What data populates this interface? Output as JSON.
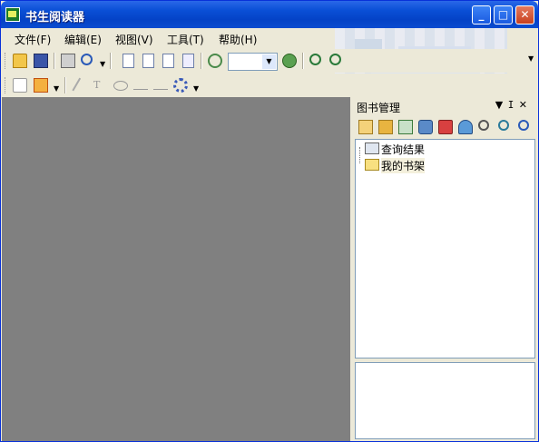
{
  "window": {
    "title": "书生阅读器"
  },
  "window_controls": {
    "minimize": "_",
    "maximize": "□",
    "close": "✕"
  },
  "menu": [
    {
      "label": "文件(F)"
    },
    {
      "label": "编辑(E)"
    },
    {
      "label": "视图(V)"
    },
    {
      "label": "工具(T)"
    },
    {
      "label": "帮助(H)"
    }
  ],
  "toolbar": {
    "zoom_value": "",
    "icons_row1": [
      "open-folder-icon",
      "save-icon",
      "print-icon",
      "find-icon",
      "page-single-icon",
      "page-double-icon",
      "page-fit-icon",
      "page-scroll-icon",
      "zoom-out-circle-icon",
      "zoom-in-circle-icon",
      "zoom-in-icon",
      "zoom-out-icon"
    ],
    "icons_row2": [
      "comment-icon",
      "highlight-icon",
      "pencil-icon",
      "text-tool-icon",
      "ellipse-tool-icon",
      "line-tool-icon",
      "arrow-line-tool-icon",
      "settings-gear-icon"
    ]
  },
  "panel": {
    "title": "图书管理",
    "controls": {
      "dropdown": "▼",
      "pin": "ⵊ",
      "close": "✕"
    },
    "tree": [
      {
        "label": "查询结果",
        "icon": "search-results-icon"
      },
      {
        "label": "我的书架",
        "icon": "folder-icon"
      }
    ]
  },
  "colors": {
    "accent": "#0a4fd6",
    "workspace": "#808080",
    "face": "#ece9d8"
  }
}
